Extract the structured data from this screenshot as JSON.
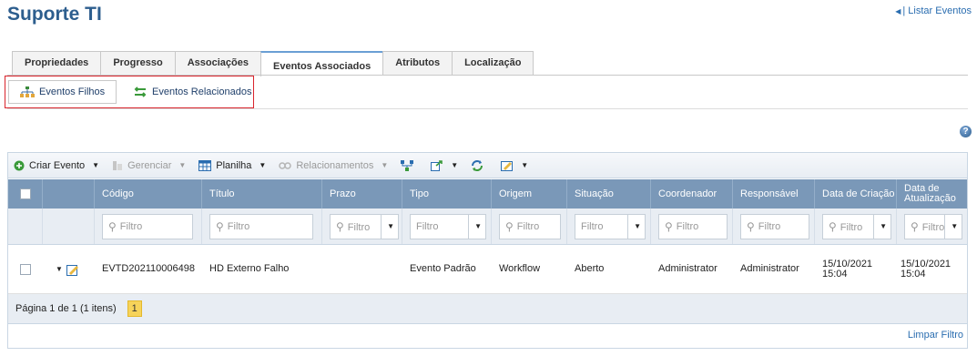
{
  "page": {
    "title": "Suporte TI",
    "top_link": "| Listar Eventos"
  },
  "tabs": [
    "Propriedades",
    "Progresso",
    "Associações",
    "Eventos Associados",
    "Atributos",
    "Localização"
  ],
  "subtabs": {
    "active": "Eventos Filhos",
    "other": "Eventos Relacionados"
  },
  "help": "?",
  "toolbar": {
    "create": "Criar Evento",
    "manage": "Gerenciar",
    "sheet": "Planilha",
    "relations": "Relacionamentos"
  },
  "columns": [
    "Código",
    "Título",
    "Prazo",
    "Tipo",
    "Origem",
    "Situação",
    "Coordenador",
    "Responsável",
    "Data de Criação",
    "Data de Atualização"
  ],
  "filters": {
    "placeholder": "Filtro"
  },
  "rows": [
    {
      "codigo": "EVTD202110006498",
      "titulo": "HD Externo Falho",
      "prazo": "",
      "tipo": "Evento Padrão",
      "origem": "Workflow",
      "situacao": "Aberto",
      "coordenador": "Administrator",
      "responsavel": "Administrator",
      "criacao": "15/10/2021 15:04",
      "atualizacao": "15/10/2021 15:04"
    }
  ],
  "pager": {
    "text": "Página 1 de 1 (1 itens)",
    "page": "1"
  },
  "footer": {
    "clear_filter": "Limpar Filtro"
  },
  "colors": {
    "title": "#2d5e8e",
    "header": "#7a98b8",
    "highlight_border": "#d9242c",
    "page_active": "#f6d35a"
  }
}
